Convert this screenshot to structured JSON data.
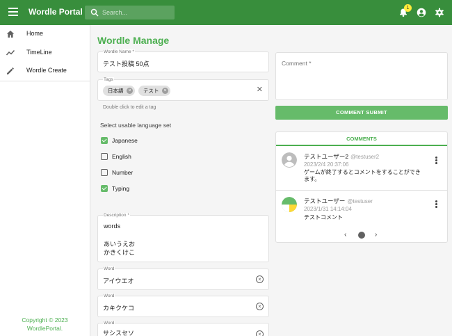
{
  "appbar": {
    "title": "Wordle Portal",
    "search_placeholder": "Search...",
    "notification_count": "1"
  },
  "sidebar": {
    "items": [
      {
        "label": "Home",
        "icon": "home-icon"
      },
      {
        "label": "TimeLine",
        "icon": "timeline-icon"
      },
      {
        "label": "Wordle Create",
        "icon": "pencil-icon"
      }
    ],
    "copyright_line1": "Copyright © 2023",
    "copyright_line2": "WordlePortal."
  },
  "form": {
    "page_title": "Wordle Manage",
    "name_label": "Wordle Name *",
    "name_value": "テスト投稿 50点",
    "tags_label": "Tags",
    "tags": [
      "日本語",
      "テスト"
    ],
    "tags_hint": "Double click to edit a tag",
    "language_label": "Select usable language set",
    "languages": [
      {
        "label": "Japanese",
        "checked": true
      },
      {
        "label": "English",
        "checked": false
      },
      {
        "label": "Number",
        "checked": false
      },
      {
        "label": "Typing",
        "checked": true
      }
    ],
    "description_label": "Description *",
    "description_lines": [
      "words",
      "",
      "あいうえお",
      "かきくけこ"
    ],
    "words": [
      {
        "label": "Word",
        "value": "アイウエオ"
      },
      {
        "label": "Word",
        "value": "カキクケコ"
      },
      {
        "label": "Word",
        "value": "サシスセソ"
      }
    ]
  },
  "comment_form": {
    "placeholder": "Comment *",
    "submit_label": "COMMENT SUBMIT"
  },
  "comments": {
    "header": "COMMENTS",
    "items": [
      {
        "name": "テストユーザー2",
        "handle": "@testuser2",
        "date": "2023/2/4 20:37:06",
        "text": "ゲームが終了するとコメントをすることができます。"
      },
      {
        "name": "テストユーザー",
        "handle": "@testuser",
        "date": "2023/1/31 14:14:04",
        "text": "テストコメント"
      }
    ],
    "pager_prev": "‹",
    "pager_next": "›"
  },
  "colors": {
    "primary": "#388e3c",
    "accent": "#4caf50",
    "button": "#66bb6a"
  }
}
